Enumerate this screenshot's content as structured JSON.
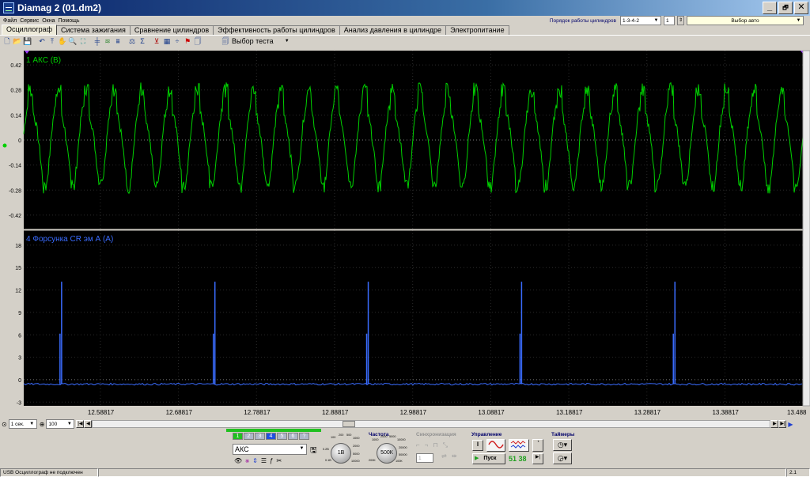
{
  "window": {
    "title": "Diamag 2 (01.dm2)",
    "minimize": "_",
    "maximize": "🗗",
    "close": "✕"
  },
  "menu": [
    "Файл",
    "Сервис",
    "Окна",
    "Помощь"
  ],
  "top_controls": {
    "firing_order_label": "Порядок работы цилиндров",
    "firing_order_value": "1-3-4-2",
    "counter_value": "1",
    "auto_select": "Выбор авто"
  },
  "tabs": [
    {
      "label": "Осциллограф",
      "active": true
    },
    {
      "label": "Система зажигания",
      "active": false
    },
    {
      "label": "Сравнение цилиндров",
      "active": false
    },
    {
      "label": "Эффективность работы цилиндров",
      "active": false
    },
    {
      "label": "Анализ давления в цилиндре",
      "active": false
    },
    {
      "label": "Электропитание",
      "active": false
    }
  ],
  "toolbar": {
    "test_select": "Выбор теста"
  },
  "chart_data": [
    {
      "type": "line",
      "title": "1 АКС (В)",
      "color": "#00d000",
      "y_ticks": [
        "0.42",
        "0.28",
        "0.14",
        "0",
        "-0.14",
        "-0.28",
        "-0.42"
      ],
      "ylim": [
        -0.5,
        0.5
      ],
      "cycle_count": 28,
      "amplitude_peak": 0.28,
      "amplitude_trough": -0.26
    },
    {
      "type": "line",
      "title": "4 Форсунка CR эм А (А)",
      "color": "#3a6cff",
      "y_ticks": [
        "18",
        "15",
        "12",
        "9",
        "6",
        "3",
        "0",
        "-3"
      ],
      "ylim": [
        -3.5,
        20
      ],
      "baseline": -0.6,
      "pulses": [
        {
          "x": 12.5385,
          "peak": 13.1
        },
        {
          "x": 12.7349,
          "peak": 13.1
        },
        {
          "x": 12.9313,
          "peak": 13.1
        },
        {
          "x": 13.1277,
          "peak": 13.1
        },
        {
          "x": 13.3241,
          "peak": 13.1
        }
      ],
      "x_ticks": [
        "12.58817",
        "12.68817",
        "12.78817",
        "12.88817",
        "12.98817",
        "13.08817",
        "13.18817",
        "13.28817",
        "13.38817",
        "13.488"
      ],
      "xlim": [
        12.49,
        13.488
      ]
    }
  ],
  "scroll_controls": {
    "time_scale": "1 сек.",
    "zoom": "100"
  },
  "channels": {
    "buttons": [
      "1",
      "2",
      "3",
      "4",
      "5",
      "6",
      "?"
    ],
    "active": "4",
    "selected_name": "АКС"
  },
  "knob_amplitude": {
    "value": "1В",
    "marks": [
      "100",
      "200",
      "500",
      "1000",
      "2000",
      "5000",
      "10000",
      "0.1В",
      "0.2В"
    ]
  },
  "frequency": {
    "label": "Частота",
    "value": "500К",
    "marks": [
      "1000",
      "2000",
      "5000",
      "10000",
      "20000",
      "50000",
      "100К",
      "200К"
    ]
  },
  "sync": {
    "label": "Синхронизация",
    "value": "1"
  },
  "control": {
    "label": "Управление",
    "start": "Пуск",
    "counter": "51 38"
  },
  "timers": {
    "label": "Таймеры"
  },
  "status": {
    "left": "USB Осциллограф не подключен",
    "right": "2.1"
  },
  "colors": {
    "scope_bg": "#000000",
    "channel1": "#00d000",
    "channel4": "#3a6cff",
    "title_bar": "#0a246a"
  }
}
